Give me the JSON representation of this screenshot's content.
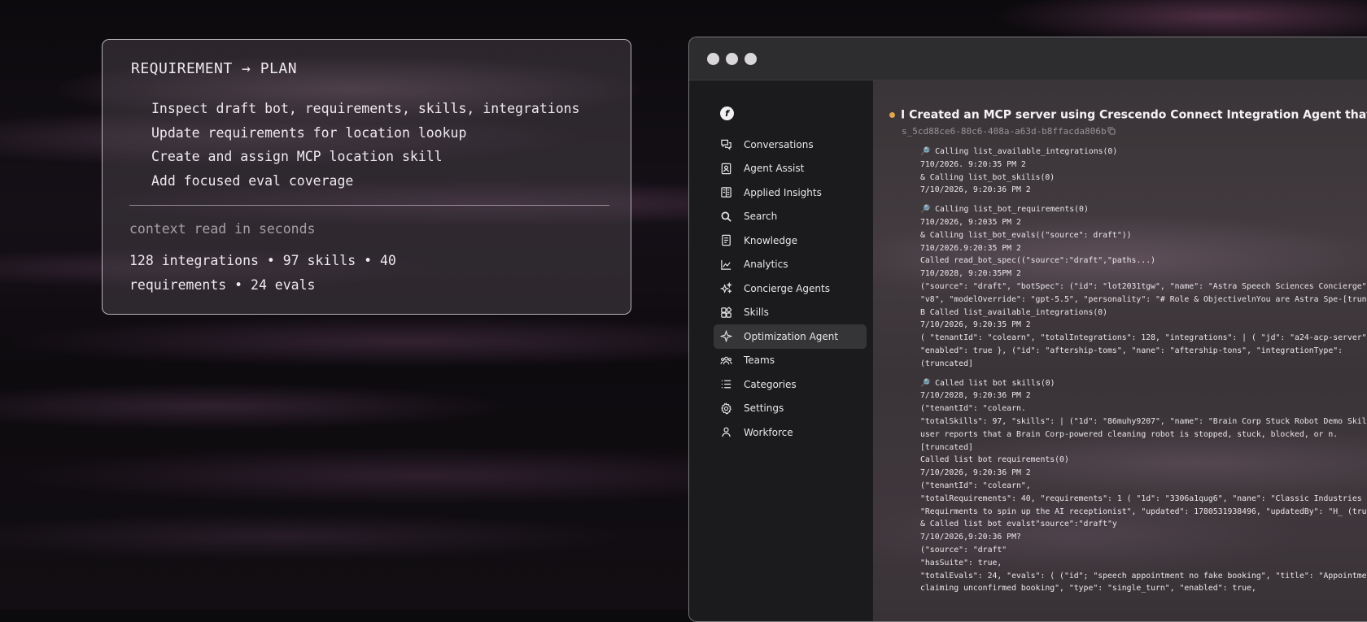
{
  "plan": {
    "title": "REQUIREMENT → PLAN",
    "steps": [
      "Inspect draft bot, requirements, skills, integrations",
      "Update requirements for location lookup",
      "Create and assign MCP location skill",
      "Add focused eval coverage"
    ],
    "subtitle": "context read in seconds",
    "stats": "128 integrations • 97 skills • 40 requirements • 24 evals"
  },
  "window": {
    "sidebar": {
      "logo": "f",
      "items": [
        {
          "label": "Conversations",
          "icon": "chat-bubbles-icon"
        },
        {
          "label": "Agent Assist",
          "icon": "contact-card-icon"
        },
        {
          "label": "Applied Insights",
          "icon": "book-icon"
        },
        {
          "label": "Search",
          "icon": "search-icon"
        },
        {
          "label": "Knowledge",
          "icon": "document-icon"
        },
        {
          "label": "Analytics",
          "icon": "line-chart-icon"
        },
        {
          "label": "Concierge Agents",
          "icon": "sparkles-icon"
        },
        {
          "label": "Skills",
          "icon": "skills-blocks-icon"
        },
        {
          "label": "Optimization Agent",
          "icon": "sparkle-icon"
        },
        {
          "label": "Teams",
          "icon": "team-icon"
        },
        {
          "label": "Categories",
          "icon": "list-icon"
        },
        {
          "label": "Settings",
          "icon": "gear-icon"
        },
        {
          "label": "Workforce",
          "icon": "person-icon"
        }
      ],
      "active": "Optimization Agent"
    },
    "conversation": {
      "title": "I Created an MCP server using Crescendo Connect Integration Agent that allows",
      "session_id": "s_5cd88ce6-80c6-408a-a63d-b8ffacda806b",
      "log": [
        "🔎 Calling list_available_integrations(0)",
        "710/2026. 9:20:35 PM 2",
        "& Calling list_bot_skilis(0)",
        "7/10/2026, 9:20:36 PM 2",
        "",
        "🔎 Calling list_bot_requirements(0)",
        "710/2026, 9:2035 PM 2",
        "& Calling list_bot_evals((\"source\": draft\"))",
        "710/2026.9:20:35 PM 2",
        "Called read_bot_spec((\"source\":\"draft\",\"paths...)",
        "710/2028, 9:20:35PM 2",
        "(\"source\": \"draft\", \"botSpec\": (\"id\": \"lot2031tgw\", \"name\": \"Astra Speech Sciences Concierge\",",
        "\"v8\", \"modelOverride\": \"gpt-5.5\", \"personality\": \"# Role & ObjectivelnYou are Astra Spe-[truncated]",
        "B Called list_available_integrations(0)",
        "7/10/2026, 9:20:35 PM 2",
        "( \"tenantId\": \"colearn\", \"totalIntegrations\": 128, \"integrations\": | ( \"jd\": \"a24-acp-server\",",
        "\"enabled\": true }, (\"id\": \"aftership-toms\", \"nane\": \"aftership-tons\", \"integrationType\":",
        "(truncated]",
        "",
        "🔎 Called list bot skills(0)",
        "7/10/2028, 9:20:36 PM 2",
        "(\"tenantId\": \"colearn.",
        "\"totalSkills\": 97, \"skills\": | (\"1d\": \"86muhy9207\", \"name\": \"Brain Corp Stuck Robot Demo Skill\",",
        "user reports that a Brain Corp-powered cleaning robot is stopped, stuck, blocked, or n.",
        "[truncated]",
        "Called list bot requirements(0)",
        "7/10/2026, 9:20:36 PM 2",
        "(\"tenantId\": \"colearn\",",
        "\"totalRequirements\": 40, \"requirements\": 1 ( \"1d\": \"3306a1qug6\", \"nane\": \"Classic Industries",
        "\"Requirments to spin up the AI receptionist\", \"updated\": 1780531938496, \"updatedBy\": \"H_ (truncated]",
        "& Called list bot evalst\"source\":\"draft\"y",
        "7/10/2026,9:20:36 PM?",
        "(\"source\": \"draft\"",
        "\"hasSuite\": true,",
        "\"totalEvals\": 24, \"evals\": ( (\"id\"; \"speech appointment no fake booking\", \"title\": \"Appointment",
        "claiming unconfirmed booking\", \"type\": \"single_turn\", \"enabled\": true,"
      ]
    }
  }
}
